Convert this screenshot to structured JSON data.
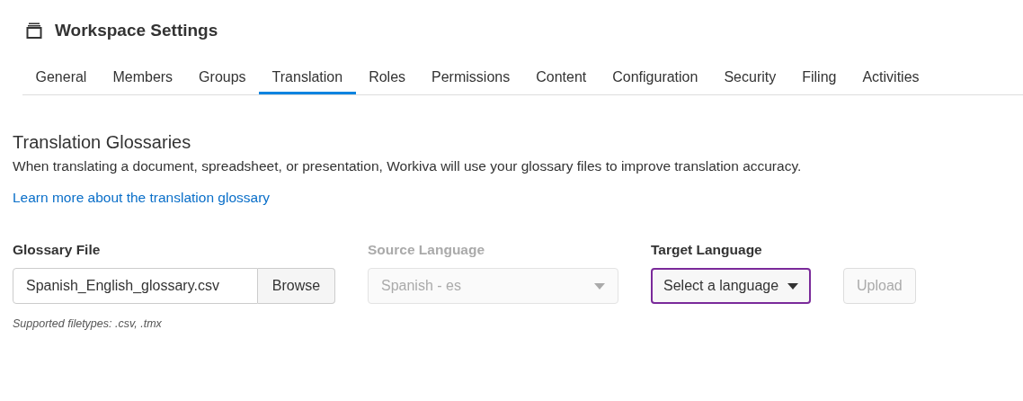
{
  "header": {
    "title": "Workspace Settings"
  },
  "tabs": [
    {
      "label": "General",
      "selected": false
    },
    {
      "label": "Members",
      "selected": false
    },
    {
      "label": "Groups",
      "selected": false
    },
    {
      "label": "Translation",
      "selected": true
    },
    {
      "label": "Roles",
      "selected": false
    },
    {
      "label": "Permissions",
      "selected": false
    },
    {
      "label": "Content",
      "selected": false
    },
    {
      "label": "Configuration",
      "selected": false
    },
    {
      "label": "Security",
      "selected": false
    },
    {
      "label": "Filing",
      "selected": false
    },
    {
      "label": "Activities",
      "selected": false
    }
  ],
  "section": {
    "title": "Translation Glossaries",
    "description": "When translating a document, spreadsheet, or presentation, Workiva will use your glossary files to improve translation accuracy.",
    "link": "Learn more about the translation glossary"
  },
  "fields": [
    {
      "kind": "file",
      "label": "Glossary File",
      "value": "Spanish_English_glossary.csv",
      "button": "Browse",
      "hint": "Supported filetypes: .csv, .tmx"
    },
    {
      "kind": "select",
      "label": "Source Language",
      "value": "Spanish - es",
      "disabled": true,
      "focused": false
    },
    {
      "kind": "select",
      "label": "Target Language",
      "value": "Select a language",
      "disabled": false,
      "focused": true
    }
  ],
  "upload_button": {
    "label": "Upload",
    "disabled": true
  }
}
